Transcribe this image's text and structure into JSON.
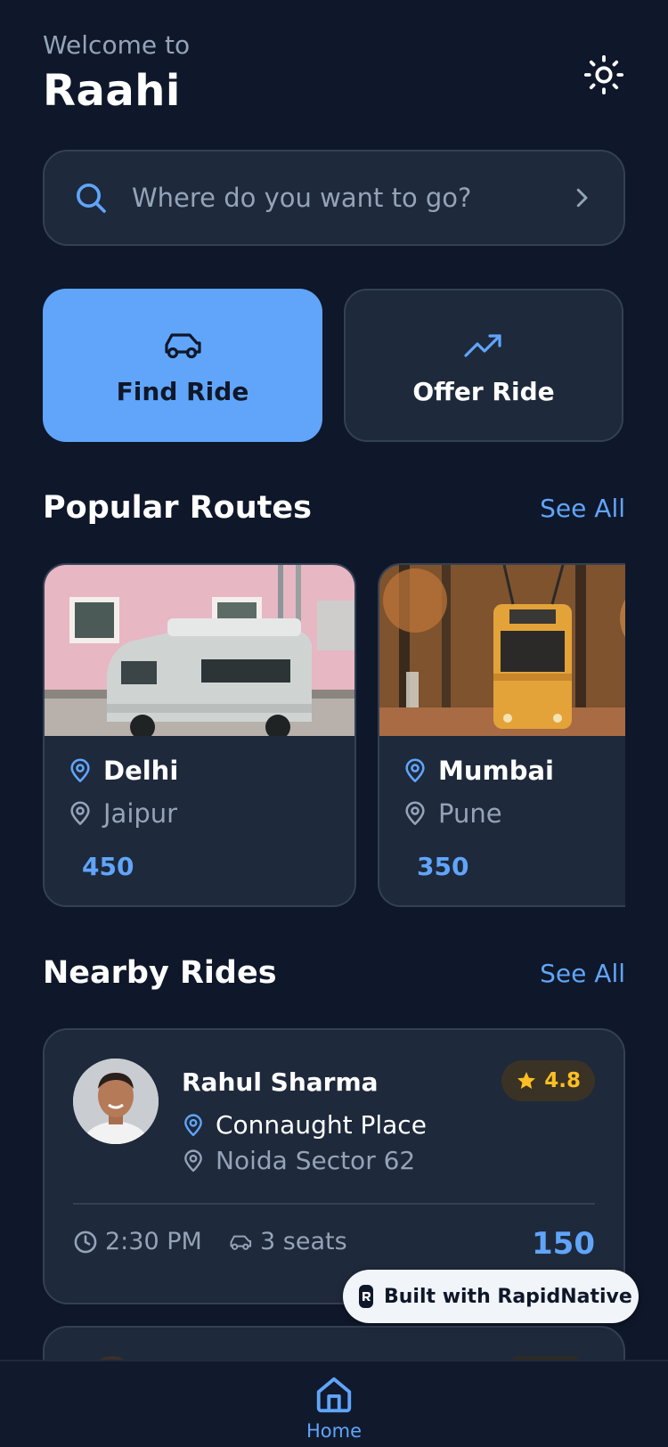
{
  "header": {
    "welcome": "Welcome to",
    "title": "Raahi",
    "theme_icon": "sun-icon"
  },
  "search": {
    "placeholder": "Where do you want to go?"
  },
  "actions": [
    {
      "label": "Find Ride",
      "icon": "car-icon",
      "active": true
    },
    {
      "label": "Offer Ride",
      "icon": "trending-up-icon",
      "active": false
    }
  ],
  "popular_routes": {
    "title": "Popular Routes",
    "see_all": "See All",
    "items": [
      {
        "from": "Delhi",
        "to": "Jaipur",
        "price": "450",
        "image": "white-van-photo"
      },
      {
        "from": "Mumbai",
        "to": "Pune",
        "price": "350",
        "image": "yellow-tram-photo"
      }
    ]
  },
  "nearby_rides": {
    "title": "Nearby Rides",
    "see_all": "See All",
    "items": [
      {
        "driver": "Rahul Sharma",
        "rating": "4.8",
        "from": "Connaught Place",
        "to": "Noida Sector 62",
        "time": "2:30 PM",
        "seats": "3 seats",
        "price": "150"
      }
    ]
  },
  "badge": {
    "text": "Built with RapidNative"
  },
  "bottom_nav": {
    "items": [
      {
        "label": "Home",
        "icon": "home-icon",
        "active": true
      }
    ]
  },
  "colors": {
    "background": "#0f172a",
    "card": "#1e293b",
    "accent": "#60a5fa",
    "rating": "#fbbf24",
    "muted": "#94a3b8"
  }
}
